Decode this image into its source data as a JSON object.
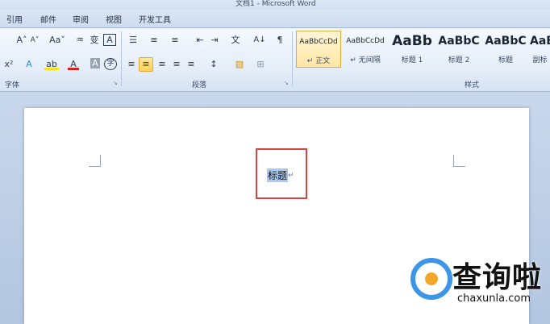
{
  "window": {
    "title": "文档1 - Microsoft Word"
  },
  "tabs": [
    "引用",
    "邮件",
    "审阅",
    "视图",
    "开发工具"
  ],
  "ribbon": {
    "groups": {
      "font": "字体",
      "paragraph": "段落",
      "styles": "样式"
    },
    "font_buttons": {
      "grow": "A˄",
      "shrink": "A˅",
      "case": "Aa˅",
      "clear": "♒",
      "phonetic": "变",
      "border": "A",
      "superscript": "x²",
      "effects": "A",
      "highlight": "ab",
      "color": "A",
      "shade": "A",
      "enclose": "字"
    },
    "para_buttons": {
      "bullets": "☰",
      "numbering": "≡",
      "multilevel": "≡",
      "dec_indent": "⇤",
      "inc_indent": "⇥",
      "chinese_layout": "文",
      "sort": "A↓",
      "show_marks": "¶",
      "align_left": "≡",
      "center": "≡",
      "align_right": "≡",
      "justify": "≡",
      "distributed": "≡",
      "line_spacing": "↕",
      "shading": "▧",
      "borders": "⊞"
    },
    "styles": [
      {
        "sample": "AaBbCcDd",
        "name": "↵ 正文",
        "selected": true
      },
      {
        "sample": "AaBbCcDd",
        "name": "↵ 无间隔",
        "selected": false
      },
      {
        "sample": "AaBb",
        "name": "标题 1",
        "selected": false
      },
      {
        "sample": "AaBbC",
        "name": "标题 2",
        "selected": false
      },
      {
        "sample": "AaBbC",
        "name": "标题",
        "selected": false
      },
      {
        "sample": "AaB",
        "name": "副标",
        "selected": false
      }
    ]
  },
  "document": {
    "selected_text": "标题",
    "paragraph_mark": "↵"
  },
  "watermark": {
    "cn": "查询啦",
    "en": "chaxunla.com"
  }
}
